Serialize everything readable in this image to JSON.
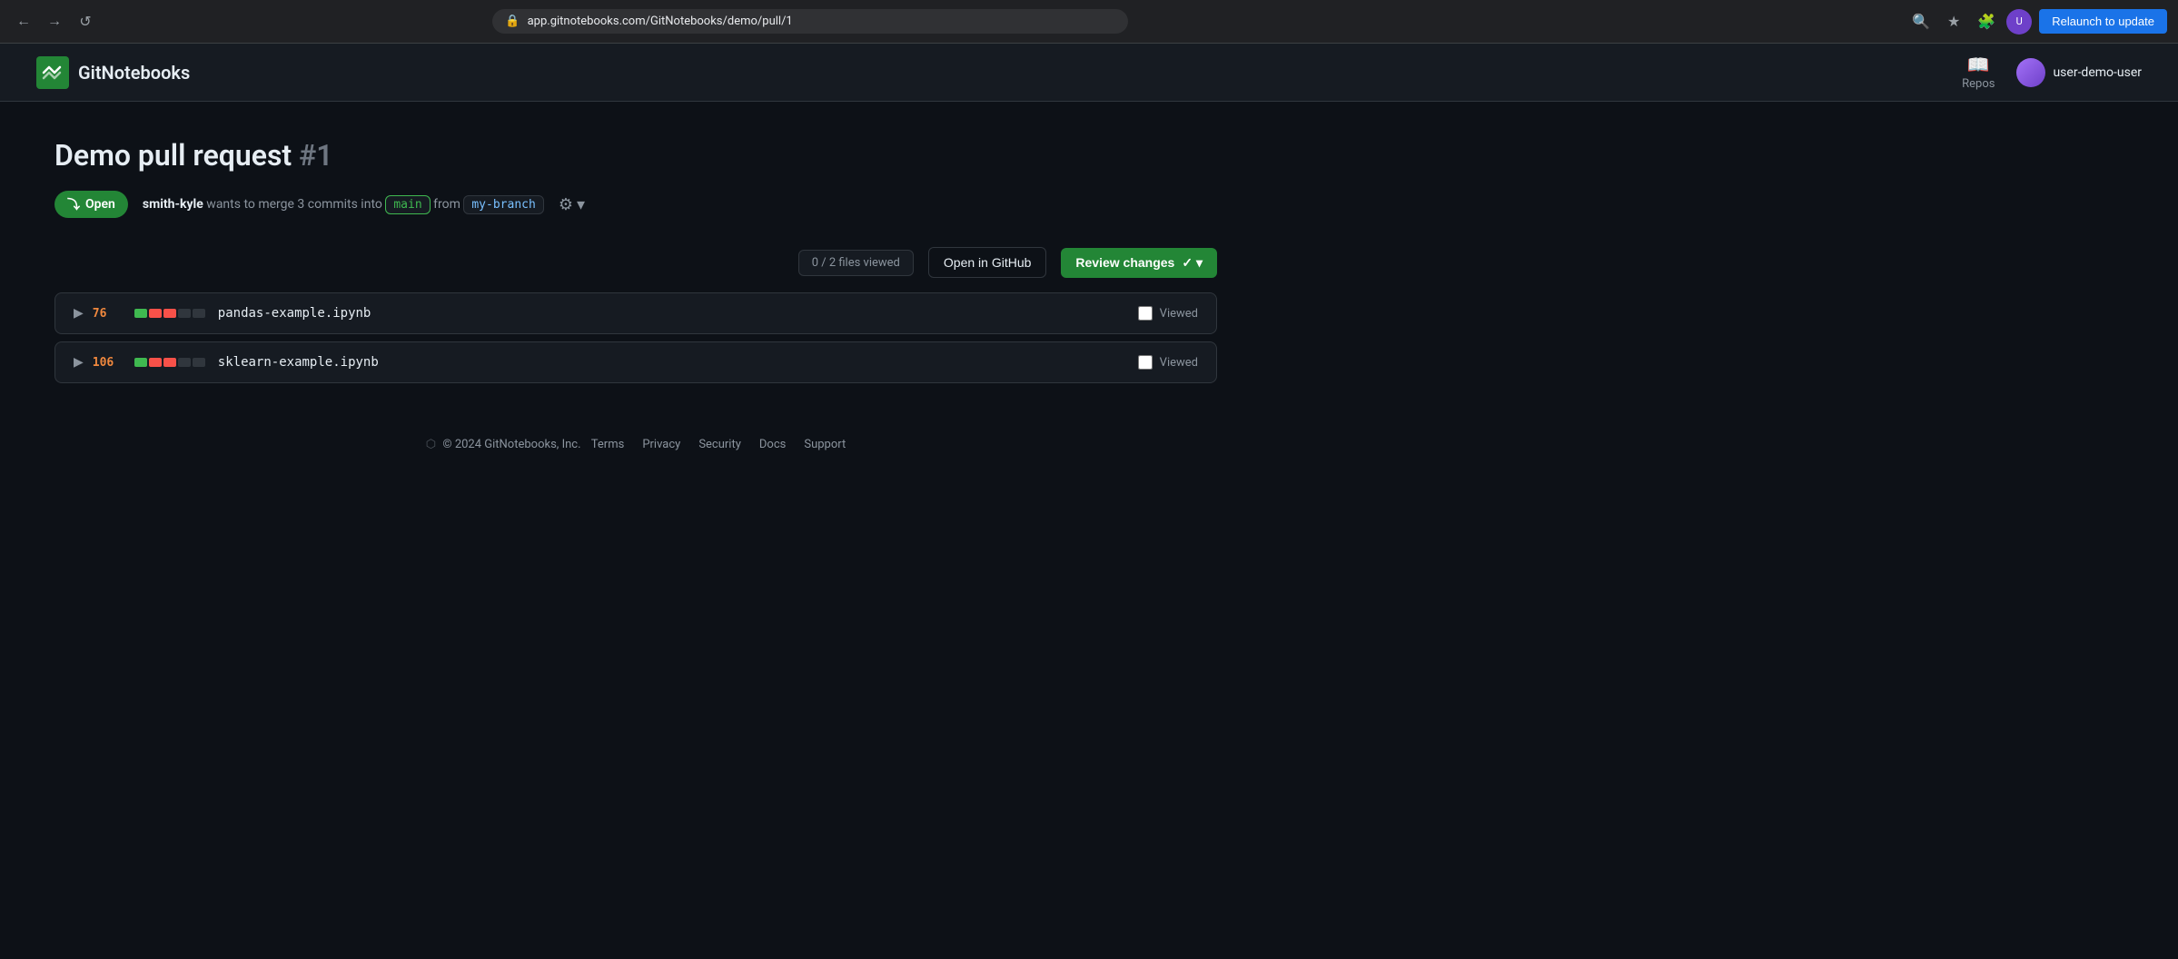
{
  "browser": {
    "back_btn": "←",
    "forward_btn": "→",
    "reload_btn": "↺",
    "url": "app.gitnotebooks.com/GitNotebooks/demo/pull/1",
    "relaunch_label": "Relaunch to update"
  },
  "nav": {
    "logo_text": "GitNotebooks",
    "repos_label": "Repos",
    "user_name": "user-demo-user"
  },
  "pr": {
    "title": "Demo pull request",
    "number": "#1",
    "status": "Open",
    "description_prefix": "wants to merge 3 commits into",
    "author": "smith-kyle",
    "base_branch": "main",
    "from_text": "from",
    "head_branch": "my-branch",
    "files_viewed": "0 / 2 files viewed",
    "open_github_label": "Open in GitHub",
    "review_changes_label": "Review changes",
    "review_changes_chevron": "✓"
  },
  "files": [
    {
      "diff_count": "76",
      "bars": [
        "green",
        "red",
        "red",
        "gray",
        "gray"
      ],
      "name": "pandas-example.ipynb",
      "viewed_label": "Viewed"
    },
    {
      "diff_count": "106",
      "bars": [
        "green",
        "red",
        "red",
        "gray",
        "gray"
      ],
      "name": "sklearn-example.ipynb",
      "viewed_label": "Viewed"
    }
  ],
  "footer": {
    "copyright": "© 2024 GitNotebooks, Inc.",
    "links": [
      "Terms",
      "Privacy",
      "Security",
      "Docs",
      "Support"
    ]
  }
}
